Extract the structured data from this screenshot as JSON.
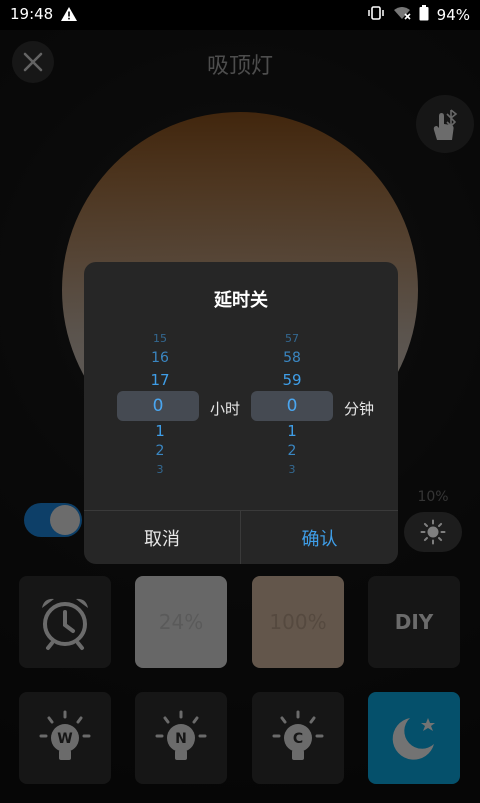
{
  "status_bar": {
    "time": "19:48",
    "battery": "94%"
  },
  "header": {
    "title": "吸顶灯"
  },
  "brightness": {
    "label": "10%",
    "level": 0.1
  },
  "tiles_row1": {
    "preset1": "24%",
    "preset2": "100%",
    "diy": "DIY"
  },
  "tiles_row2": {
    "warm": "W",
    "neutral": "N",
    "cool": "C"
  },
  "dialog": {
    "title": "延时关",
    "hours": {
      "above": [
        "15",
        "16",
        "17"
      ],
      "selected": "0",
      "below": [
        "1",
        "2",
        "3"
      ],
      "unit": "小时"
    },
    "minutes": {
      "above": [
        "57",
        "58",
        "59"
      ],
      "selected": "0",
      "below": [
        "1",
        "2",
        "3"
      ],
      "unit": "分钟"
    },
    "cancel": "取消",
    "confirm": "确认"
  },
  "colors": {
    "accent": "#3f9ee8",
    "toggle_on": "#1a7fd0",
    "night_tile": "#0aa0d6"
  }
}
